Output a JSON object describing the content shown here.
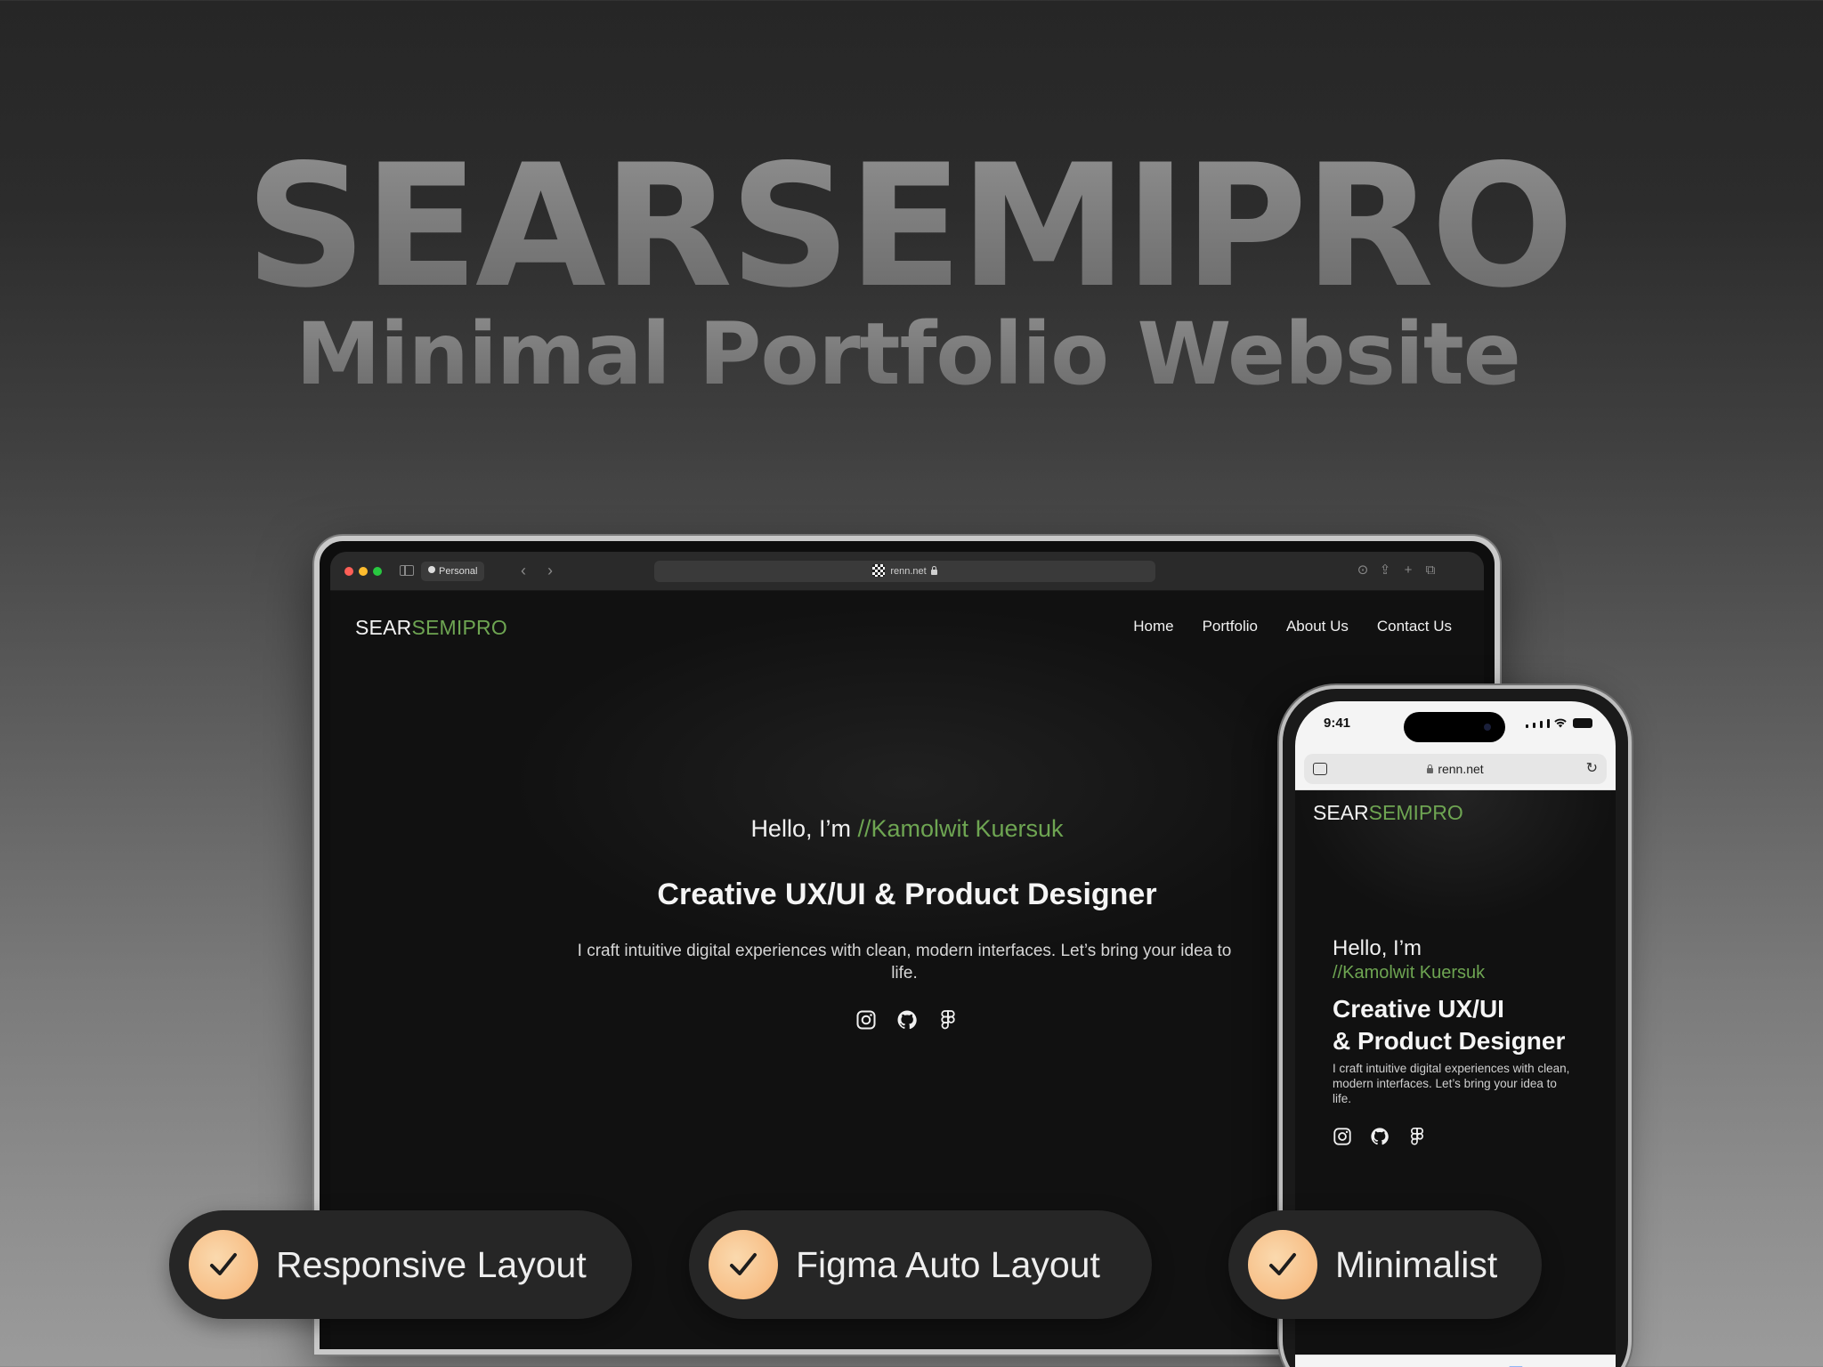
{
  "hero": {
    "title": "SEARSEMIPRO",
    "subtitle": "Minimal Portfolio Website"
  },
  "browser": {
    "profile_label": "Personal",
    "url": "renn.net",
    "icons": [
      "sidebar-toggle-icon",
      "chevron-left-icon",
      "chevron-right-icon",
      "download-icon",
      "share-icon",
      "plus-icon",
      "tabs-icon"
    ]
  },
  "site": {
    "logo_prefix": "SEAR",
    "logo_accent": "SEMIPRO",
    "nav": [
      "Home",
      "Portfolio",
      "About Us",
      "Contact Us"
    ],
    "greeting_prefix": "Hello, I’m ",
    "name": "//Kamolwit Kuersuk",
    "headline": "Creative UX/UI & Product Designer",
    "description": "I craft intuitive digital experiences with clean, modern interfaces. Let’s bring your idea to life.",
    "social_icons": [
      "instagram-icon",
      "github-icon",
      "figma-icon"
    ]
  },
  "phone": {
    "time": "9:41",
    "url": "renn.net",
    "greeting": "Hello, I’m",
    "name": "//Kamolwit Kuersuk",
    "headline_line1": "Creative UX/UI",
    "headline_line2": "& Product Designer",
    "description": "I craft intuitive digital experiences with clean, modern interfaces. Let’s bring your idea to life."
  },
  "features": [
    {
      "label": "Responsive Layout"
    },
    {
      "label": "Figma Auto Layout"
    },
    {
      "label": "Minimalist"
    }
  ],
  "colors": {
    "accent_green": "#6ea552",
    "check_orange": "#f7bd84",
    "screen_bg": "#111111"
  }
}
